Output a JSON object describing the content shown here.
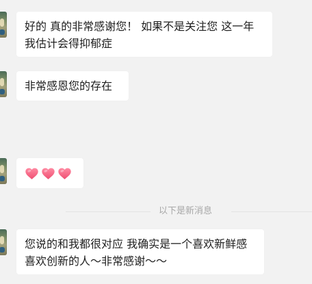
{
  "chat": {
    "messages": [
      {
        "type": "text",
        "text": "好的 真的非常感谢您！ 如果不是关注您 这一年我估计会得抑郁症"
      },
      {
        "type": "text",
        "text": "非常感恩您的存在"
      },
      {
        "type": "emoji",
        "icons": [
          "heart-icon",
          "heart-icon",
          "heart-icon"
        ]
      },
      {
        "type": "text",
        "text": "您说的和我都很对应 我确实是一个喜欢新鲜感 喜欢创新的人～非常感谢～～"
      }
    ],
    "new_messages_divider": "以下是新消息"
  },
  "colors": {
    "background": "#f2f2f2",
    "bubble": "#ffffff",
    "text": "#1f1f1f",
    "divider_text": "#a7a7a7",
    "divider_line": "#e3e3e3",
    "heart": "#f25d7c"
  }
}
